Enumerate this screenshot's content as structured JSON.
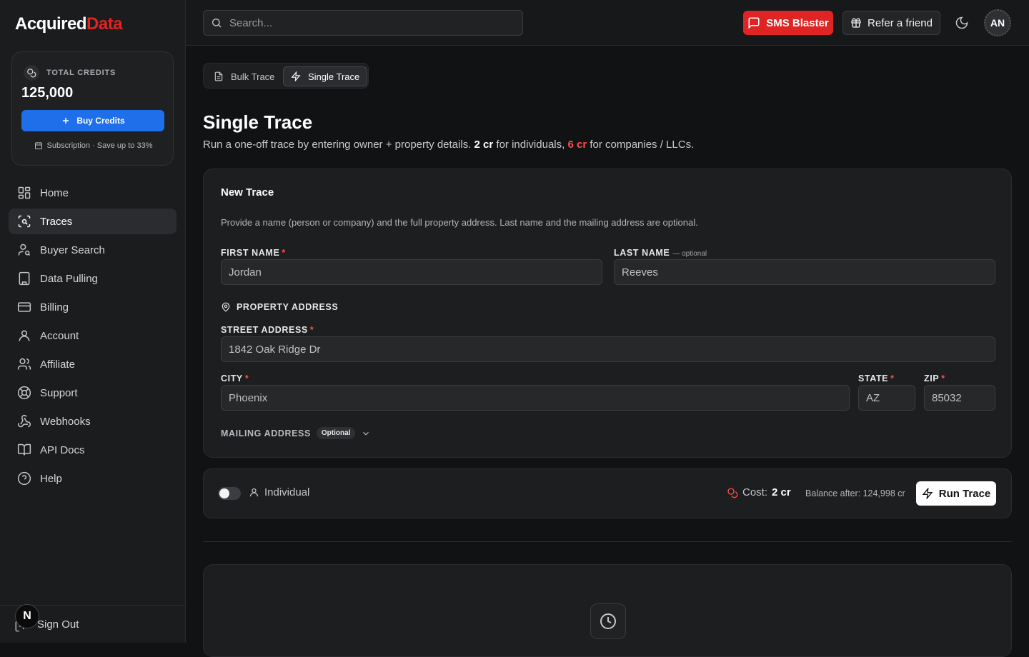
{
  "app": {
    "logo_main": "Acquired",
    "logo_accent": "Data"
  },
  "credits": {
    "label": "TOTAL CREDITS",
    "value": "125,000",
    "buy_label": "Buy Credits",
    "subscription_text": "Subscription · Save up to 33%"
  },
  "nav": {
    "items": [
      {
        "label": "Home",
        "icon": "grid-icon"
      },
      {
        "label": "Traces",
        "icon": "scan-search-icon",
        "active": true
      },
      {
        "label": "Buyer Search",
        "icon": "user-search-icon"
      },
      {
        "label": "Data Pulling",
        "icon": "building-icon"
      },
      {
        "label": "Billing",
        "icon": "credit-card-icon"
      },
      {
        "label": "Account",
        "icon": "user-icon"
      },
      {
        "label": "Affiliate",
        "icon": "users-icon"
      },
      {
        "label": "Support",
        "icon": "lifebuoy-icon"
      },
      {
        "label": "Webhooks",
        "icon": "webhook-icon"
      },
      {
        "label": "API Docs",
        "icon": "book-icon"
      },
      {
        "label": "Help",
        "icon": "help-circle-icon"
      }
    ],
    "sign_out": "Sign Out",
    "badge": "N"
  },
  "topbar": {
    "search_placeholder": "Search...",
    "sms_label": "SMS Blaster",
    "refer_label": "Refer a friend",
    "avatar": "AN"
  },
  "tabs": [
    {
      "label": "Bulk Trace"
    },
    {
      "label": "Single Trace",
      "active": true
    }
  ],
  "page": {
    "title": "Single Trace",
    "sub_prefix": "Run a one-off trace by entering owner + property details.",
    "sub_cost_individual": "2 cr",
    "sub_mid": "for individuals,",
    "sub_cost_company": "6 cr",
    "sub_suffix": "for companies / LLCs."
  },
  "form": {
    "title": "New Trace",
    "description": "Provide a name (person or company) and the full property address. Last name and the mailing address are optional.",
    "first_name_label": "FIRST NAME",
    "first_name_value": "Jordan",
    "last_name_label": "LAST NAME",
    "last_name_optional": "— optional",
    "last_name_value": "Reeves",
    "property_address_label": "PROPERTY ADDRESS",
    "street_label": "STREET ADDRESS",
    "street_value": "1842 Oak Ridge Dr",
    "city_label": "CITY",
    "city_value": "Phoenix",
    "state_label": "STATE",
    "state_value": "AZ",
    "zip_label": "ZIP",
    "zip_value": "85032",
    "required_mark": "*",
    "mailing_label": "MAILING ADDRESS",
    "mailing_pill": "Optional"
  },
  "action": {
    "type_label": "Individual",
    "cost_label": "Cost:",
    "cost_value": "2 cr",
    "balance_text": "Balance after: 124,998 cr",
    "run_label": "Run Trace"
  },
  "colors": {
    "accent_red": "#e02424",
    "primary_blue": "#1f6feb"
  }
}
